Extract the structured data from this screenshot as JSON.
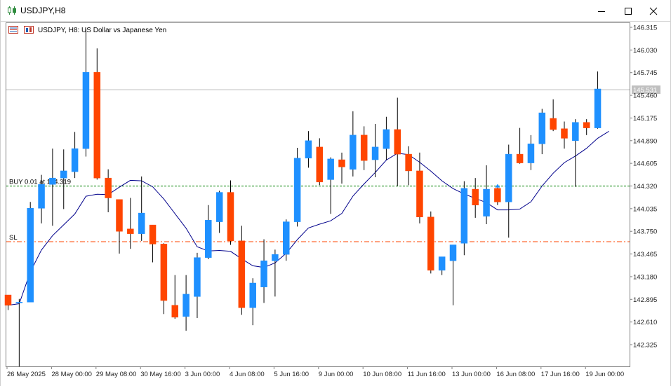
{
  "window": {
    "title": "USDJPY,H8",
    "minimize_glyph": "—",
    "maximize_glyph": "☐",
    "close_glyph": "✕"
  },
  "chart_header": {
    "text": "USDJPY, H8:  US Dollar vs Japanese Yen"
  },
  "order_lines": {
    "buy_label": "BUY 0.01 at 144.319",
    "buy_price": 144.319,
    "sl_label": "SL",
    "sl_price": 143.62,
    "bid_price": 145.531,
    "bid_label": "145.531"
  },
  "colors": {
    "bull": "#1e90ff",
    "bear": "#ff4500",
    "ma_line": "#00008b",
    "buy_line": "#008000",
    "sl_line": "#ff4500",
    "bid_line": "#c0c0c0",
    "price_tag_bg": "#c0c0c0",
    "grid_frame": "#7f7f7f"
  },
  "chart_data": {
    "type": "candlestick",
    "symbol": "USDJPY",
    "timeframe": "H8",
    "title": "USDJPY, H8:  US Dollar vs Japanese Yen",
    "ylim": [
      142.07,
      146.37
    ],
    "y_ticks": [
      "146.315",
      "146.030",
      "145.745",
      "145.460",
      "145.175",
      "144.890",
      "144.605",
      "144.320",
      "144.035",
      "143.750",
      "143.465",
      "143.180",
      "142.895",
      "142.610",
      "142.325"
    ],
    "x_ticks": [
      {
        "label": "26 May 2025",
        "index": 0
      },
      {
        "label": "28 May 00:00",
        "index": 4
      },
      {
        "label": "29 May 08:00",
        "index": 8
      },
      {
        "label": "30 May 16:00",
        "index": 12
      },
      {
        "label": "3 Jun 00:00",
        "index": 16
      },
      {
        "label": "4 Jun 08:00",
        "index": 20
      },
      {
        "label": "5 Jun 16:00",
        "index": 24
      },
      {
        "label": "9 Jun 00:00",
        "index": 28
      },
      {
        "label": "10 Jun 08:00",
        "index": 32
      },
      {
        "label": "11 Jun 16:00",
        "index": 36
      },
      {
        "label": "13 Jun 00:00",
        "index": 40
      },
      {
        "label": "16 Jun 08:00",
        "index": 44
      },
      {
        "label": "17 Jun 16:00",
        "index": 48
      },
      {
        "label": "19 Jun 00:00",
        "index": 52
      }
    ],
    "candles": [
      {
        "o": 142.95,
        "h": 142.95,
        "l": 142.76,
        "c": 142.82
      },
      {
        "o": 142.86,
        "h": 142.9,
        "l": 142.05,
        "c": 142.86
      },
      {
        "o": 142.86,
        "h": 144.12,
        "l": 142.86,
        "c": 144.04
      },
      {
        "o": 144.04,
        "h": 144.46,
        "l": 143.85,
        "c": 144.34
      },
      {
        "o": 144.34,
        "h": 144.79,
        "l": 143.82,
        "c": 144.42
      },
      {
        "o": 144.42,
        "h": 144.78,
        "l": 144.03,
        "c": 144.51
      },
      {
        "o": 144.5,
        "h": 145.0,
        "l": 144.42,
        "c": 144.79
      },
      {
        "o": 144.79,
        "h": 146.3,
        "l": 144.69,
        "c": 145.75
      },
      {
        "o": 145.75,
        "h": 146.05,
        "l": 144.4,
        "c": 144.42
      },
      {
        "o": 144.42,
        "h": 144.53,
        "l": 143.99,
        "c": 144.17
      },
      {
        "o": 144.15,
        "h": 144.15,
        "l": 143.47,
        "c": 143.75
      },
      {
        "o": 143.78,
        "h": 144.17,
        "l": 143.53,
        "c": 143.72
      },
      {
        "o": 143.72,
        "h": 144.44,
        "l": 143.63,
        "c": 143.98
      },
      {
        "o": 143.83,
        "h": 143.83,
        "l": 143.36,
        "c": 143.59
      },
      {
        "o": 143.59,
        "h": 143.6,
        "l": 142.71,
        "c": 142.88
      },
      {
        "o": 142.82,
        "h": 143.2,
        "l": 142.65,
        "c": 142.67
      },
      {
        "o": 142.68,
        "h": 143.2,
        "l": 142.5,
        "c": 142.96
      },
      {
        "o": 142.93,
        "h": 143.48,
        "l": 142.66,
        "c": 143.42
      },
      {
        "o": 143.42,
        "h": 144.08,
        "l": 143.4,
        "c": 143.89
      },
      {
        "o": 143.87,
        "h": 144.26,
        "l": 143.73,
        "c": 144.24
      },
      {
        "o": 144.24,
        "h": 144.39,
        "l": 143.58,
        "c": 143.63
      },
      {
        "o": 143.63,
        "h": 143.82,
        "l": 142.7,
        "c": 142.79
      },
      {
        "o": 142.79,
        "h": 143.16,
        "l": 142.57,
        "c": 143.1
      },
      {
        "o": 143.05,
        "h": 143.65,
        "l": 142.85,
        "c": 143.38
      },
      {
        "o": 143.38,
        "h": 143.52,
        "l": 142.93,
        "c": 143.46
      },
      {
        "o": 143.46,
        "h": 143.9,
        "l": 143.38,
        "c": 143.87
      },
      {
        "o": 143.87,
        "h": 144.8,
        "l": 143.81,
        "c": 144.67
      },
      {
        "o": 144.67,
        "h": 145.01,
        "l": 144.55,
        "c": 144.89
      },
      {
        "o": 144.81,
        "h": 144.92,
        "l": 144.33,
        "c": 144.37
      },
      {
        "o": 144.4,
        "h": 144.68,
        "l": 143.97,
        "c": 144.66
      },
      {
        "o": 144.65,
        "h": 144.74,
        "l": 144.35,
        "c": 144.56
      },
      {
        "o": 144.53,
        "h": 145.26,
        "l": 144.44,
        "c": 144.96
      },
      {
        "o": 144.96,
        "h": 145.07,
        "l": 144.52,
        "c": 144.64
      },
      {
        "o": 144.65,
        "h": 145.1,
        "l": 144.43,
        "c": 144.81
      },
      {
        "o": 144.79,
        "h": 145.19,
        "l": 144.65,
        "c": 145.03
      },
      {
        "o": 145.03,
        "h": 145.43,
        "l": 144.32,
        "c": 144.72
      },
      {
        "o": 144.72,
        "h": 144.82,
        "l": 144.33,
        "c": 144.51
      },
      {
        "o": 144.51,
        "h": 144.74,
        "l": 143.85,
        "c": 143.93
      },
      {
        "o": 143.93,
        "h": 144.0,
        "l": 143.22,
        "c": 143.26
      },
      {
        "o": 143.26,
        "h": 143.43,
        "l": 143.2,
        "c": 143.43
      },
      {
        "o": 143.38,
        "h": 143.58,
        "l": 142.82,
        "c": 143.58
      },
      {
        "o": 143.6,
        "h": 144.38,
        "l": 143.45,
        "c": 144.29
      },
      {
        "o": 144.28,
        "h": 144.42,
        "l": 143.92,
        "c": 144.08
      },
      {
        "o": 143.94,
        "h": 144.58,
        "l": 143.84,
        "c": 144.28
      },
      {
        "o": 144.29,
        "h": 144.3,
        "l": 144.08,
        "c": 144.12
      },
      {
        "o": 144.12,
        "h": 144.84,
        "l": 143.67,
        "c": 144.72
      },
      {
        "o": 144.72,
        "h": 145.05,
        "l": 144.6,
        "c": 144.61
      },
      {
        "o": 144.61,
        "h": 144.96,
        "l": 144.52,
        "c": 144.85
      },
      {
        "o": 144.85,
        "h": 145.29,
        "l": 144.72,
        "c": 145.24
      },
      {
        "o": 145.17,
        "h": 145.41,
        "l": 145.01,
        "c": 145.03
      },
      {
        "o": 145.04,
        "h": 145.13,
        "l": 144.79,
        "c": 144.92
      },
      {
        "o": 144.89,
        "h": 145.16,
        "l": 144.31,
        "c": 145.12
      },
      {
        "o": 145.12,
        "h": 145.16,
        "l": 144.96,
        "c": 145.05
      },
      {
        "o": 145.05,
        "h": 145.76,
        "l": 145.04,
        "c": 145.54
      }
    ],
    "ma_period": 10
  }
}
